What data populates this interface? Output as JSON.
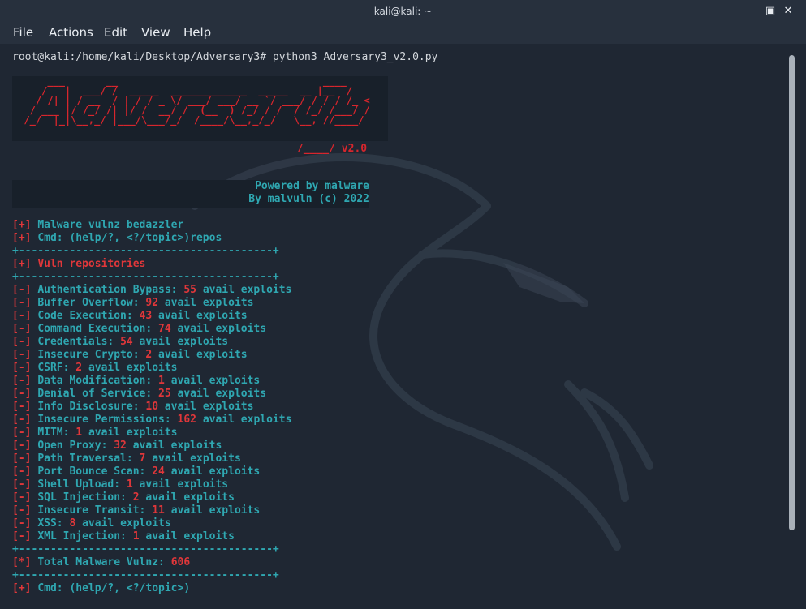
{
  "window": {
    "title": "kali@kali: ~"
  },
  "menu": [
    "File",
    "Actions",
    "Edit",
    "View",
    "Help"
  ],
  "prompt": "root@kali:/home/kali/Desktop/Adversary3# python3 Adversary3_v2.0.py",
  "banner": {
    "art": "      ___       __                                   ____\n     /   |  ___/ /  _____  _____________  _____  __ |__  /\n    / /| | / __  / | / / _ \\/ ___/ ___/ __ `/ ___/ / / / /_ <\n   / ___ |/ /_/ /| |/ /  __/ /  (__  ) /_/ / /  / /_/ /___/ /\n  /_/  |_|\\__,_/ |___/\\___/_/  /____/\\__,_/_/   \\__, //____/\n",
    "version": "/____/ v2.0"
  },
  "credits": {
    "line1": "Powered by malware",
    "line2": "By malvuln (c) 2022"
  },
  "intro": [
    {
      "tag": "[+]",
      "text": "Malware vulnz bedazzler"
    },
    {
      "tag": "[+]",
      "text": "Cmd: (help/?, <?/topic>)repos"
    }
  ],
  "rule": "+----------------------------------------+",
  "section_title": {
    "tag": "[+]",
    "text": "Vuln repositories"
  },
  "repositories": [
    {
      "name": "Authentication Bypass:",
      "count": "55",
      "suffix": "avail exploits"
    },
    {
      "name": "Buffer Overflow:",
      "count": "92",
      "suffix": "avail exploits"
    },
    {
      "name": "Code Execution:",
      "count": "43",
      "suffix": "avail exploits"
    },
    {
      "name": "Command Execution:",
      "count": "74",
      "suffix": "avail exploits"
    },
    {
      "name": "Credentials:",
      "count": "54",
      "suffix": "avail exploits"
    },
    {
      "name": "Insecure Crypto:",
      "count": "2",
      "suffix": "avail exploits"
    },
    {
      "name": "CSRF:",
      "count": "2",
      "suffix": "avail exploits"
    },
    {
      "name": "Data Modification:",
      "count": "1",
      "suffix": "avail exploits"
    },
    {
      "name": "Denial of Service:",
      "count": "25",
      "suffix": "avail exploits"
    },
    {
      "name": "Info Disclosure:",
      "count": "10",
      "suffix": "avail exploits"
    },
    {
      "name": "Insecure Permissions:",
      "count": "162",
      "suffix": "avail exploits"
    },
    {
      "name": "MITM:",
      "count": "1",
      "suffix": "avail exploits"
    },
    {
      "name": "Open Proxy:",
      "count": "32",
      "suffix": "avail exploits"
    },
    {
      "name": "Path Traversal:",
      "count": "7",
      "suffix": "avail exploits"
    },
    {
      "name": "Port Bounce Scan:",
      "count": "24",
      "suffix": "avail exploits"
    },
    {
      "name": "Shell Upload:",
      "count": "1",
      "suffix": "avail exploits"
    },
    {
      "name": "SQL Injection:",
      "count": "2",
      "suffix": "avail exploits"
    },
    {
      "name": "Insecure Transit:",
      "count": "11",
      "suffix": "avail exploits"
    },
    {
      "name": "XSS:",
      "count": "8",
      "suffix": "avail exploits"
    },
    {
      "name": "XML Injection:",
      "count": "1",
      "suffix": "avail exploits"
    }
  ],
  "repo_tag": "[-]",
  "total": {
    "tag": "[*]",
    "label": "Total Malware Vulnz:",
    "value": "606"
  },
  "final_prompt": {
    "tag": "[+]",
    "text": "Cmd: (help/?, <?/topic>)"
  },
  "colors": {
    "red": "#e0373a",
    "teal": "#2fa7b1",
    "background": "#1f2733",
    "titlebar": "#27303d"
  }
}
